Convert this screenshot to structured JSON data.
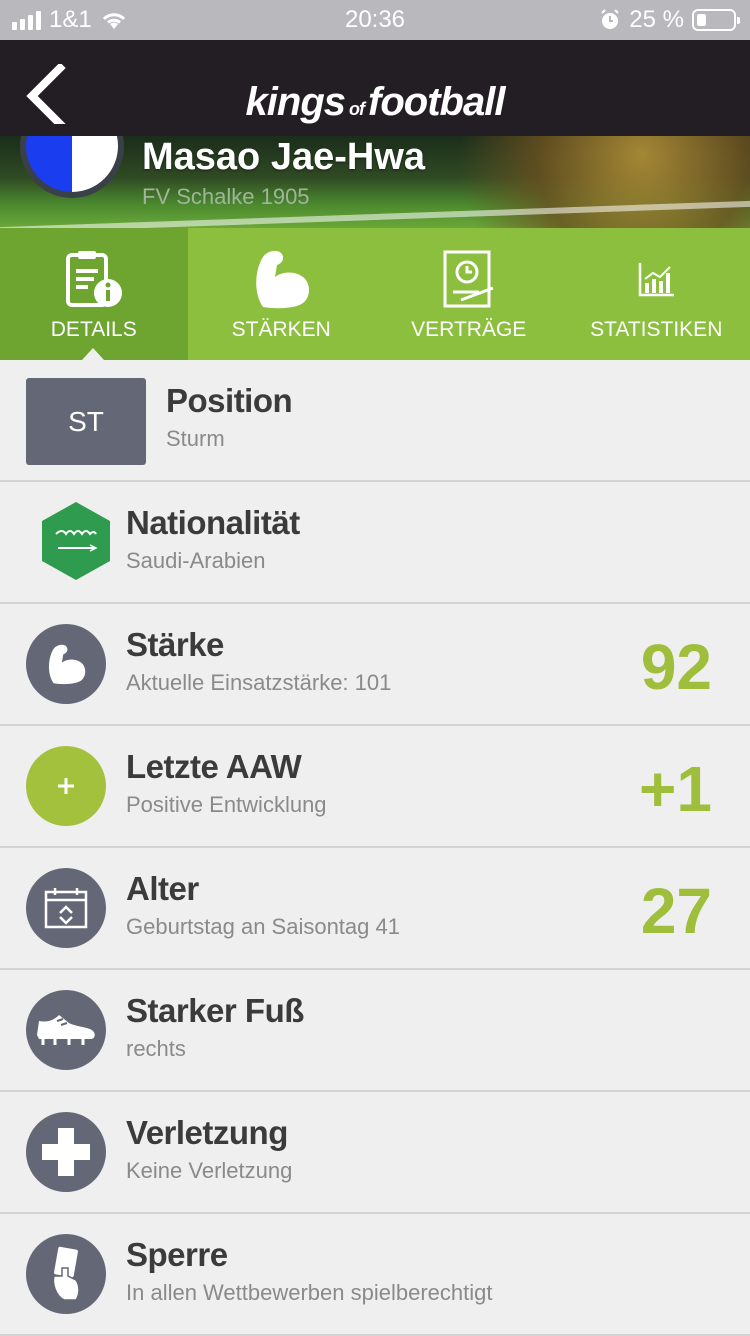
{
  "status_bar": {
    "carrier": "1&1",
    "time": "20:36",
    "battery_percent": "25 %"
  },
  "navbar": {
    "logo_kings": "kings",
    "logo_of": "of",
    "logo_football": "football",
    "back_icon": "chevron-left-icon"
  },
  "hero": {
    "player_name": "Masao Jae-Hwa",
    "club": "FV Schalke 1905",
    "crest_colors": [
      "#1a3df0",
      "#ffffff"
    ]
  },
  "tabs": [
    {
      "label": "DETAILS",
      "icon": "document-info-icon",
      "active": true
    },
    {
      "label": "STÄRKEN",
      "icon": "biceps-icon",
      "active": false
    },
    {
      "label": "VERTRÄGE",
      "icon": "contract-clock-icon",
      "active": false
    },
    {
      "label": "STATISTIKEN",
      "icon": "bar-chart-icon",
      "active": false
    }
  ],
  "details": {
    "position": {
      "badge": "ST",
      "title": "Position",
      "subtitle": "Sturm"
    },
    "nationality": {
      "title": "Nationalität",
      "subtitle": "Saudi-Arabien",
      "flag_color": "#2f9b4e"
    },
    "strength": {
      "title": "Stärke",
      "subtitle": "Aktuelle Einsatzstärke: 101",
      "value": "92",
      "icon": "biceps-icon"
    },
    "last_aaw": {
      "title": "Letzte AAW",
      "subtitle": "Positive Entwicklung",
      "value": "+1",
      "icon": "plus-icon"
    },
    "age": {
      "title": "Alter",
      "subtitle": "Geburtstag an Saisontag 41",
      "value": "27",
      "icon": "calendar-icon"
    },
    "foot": {
      "title": "Starker Fuß",
      "subtitle": "rechts",
      "icon": "shoe-icon"
    },
    "injury": {
      "title": "Verletzung",
      "subtitle": "Keine Verletzung",
      "icon": "cross-icon"
    },
    "suspension": {
      "title": "Sperre",
      "subtitle": "In allen Wettbewerben spielberechtigt",
      "icon": "card-hand-icon"
    }
  },
  "colors": {
    "accent_green": "#8dbf3f",
    "active_tab_green": "#6ea531",
    "value_green": "#9ebe3c",
    "icon_gray": "#646876",
    "navbar": "#231d24"
  }
}
